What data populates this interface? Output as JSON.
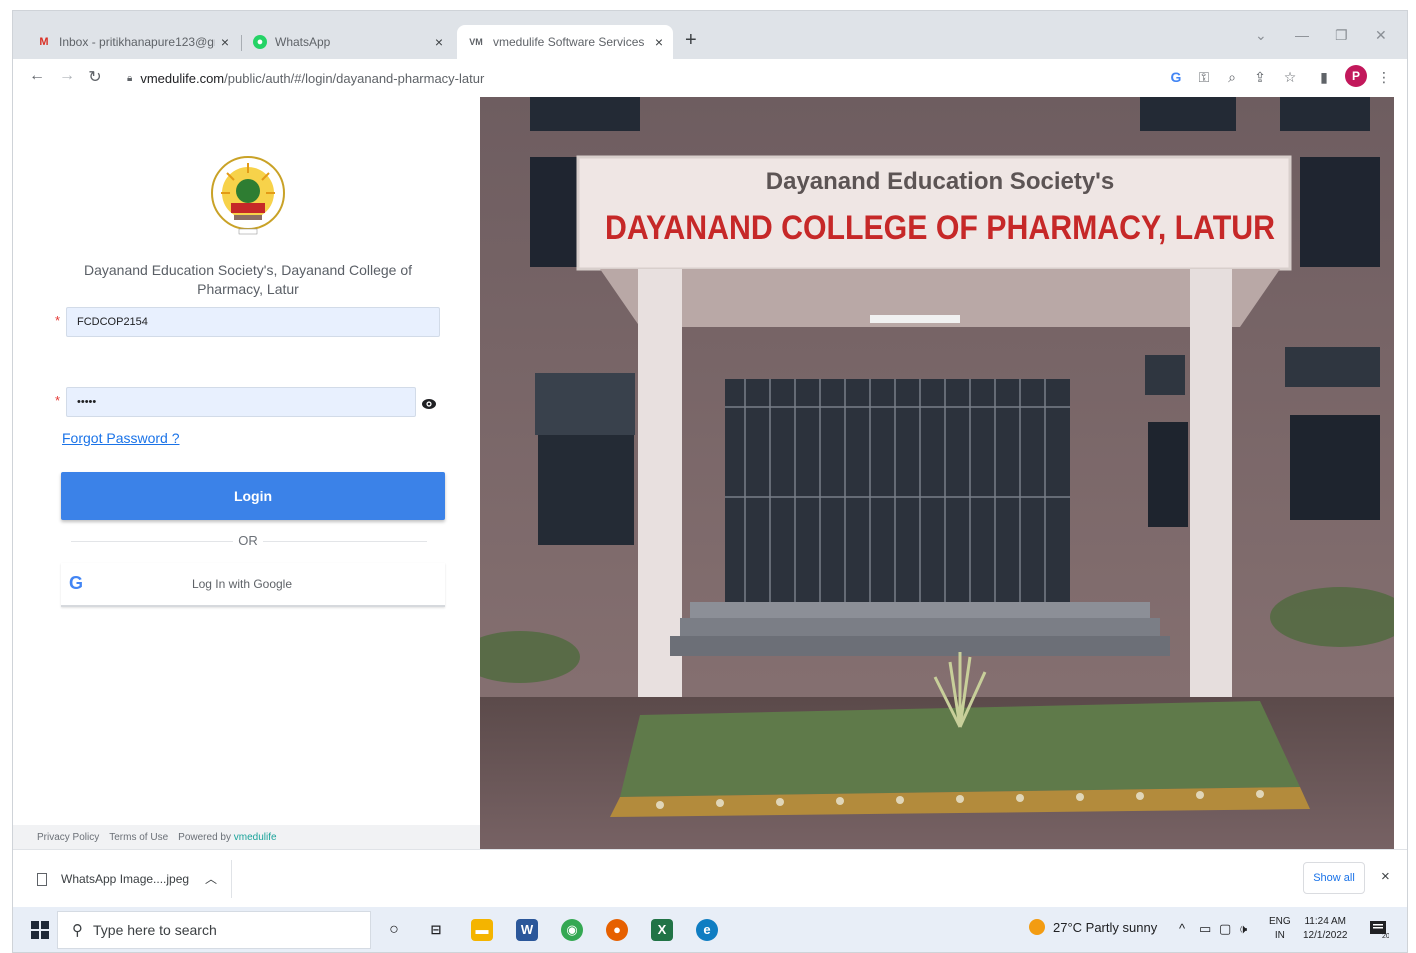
{
  "tabs": [
    {
      "title": "Inbox - pritikhanapure123@gm..."
    },
    {
      "title": "WhatsApp"
    },
    {
      "title": "vmedulife Software Services"
    }
  ],
  "address": {
    "host": "vmedulife.com",
    "path": "/public/auth/#/login/dayanand-pharmacy-latur"
  },
  "profile_initial": "P",
  "login": {
    "org_name": "Dayanand Education Society's, Dayanand College of Pharmacy, Latur",
    "username_value": "FCDCOP2154",
    "password_value": "•••••",
    "required_mark": "*",
    "forgot_label": "Forgot Password ?",
    "login_label": "Login",
    "or_label": "OR",
    "google_label": "Log In with Google",
    "google_glyph": "G"
  },
  "footer": {
    "privacy": "Privacy Policy",
    "terms": "Terms of Use",
    "powered": "Powered by",
    "brand": "vmedulife"
  },
  "photo": {
    "society_sign": "Dayanand Education Society's",
    "college_sign": "DAYANAND COLLEGE OF PHARMACY, LATUR"
  },
  "downloads": {
    "file": "WhatsApp Image....jpeg",
    "show_all": "Show all",
    "close": "×"
  },
  "taskbar": {
    "search_placeholder": "Type here to search",
    "weather": "27°C  Partly sunny",
    "lang_top": "ENG",
    "lang_bottom": "IN",
    "time": "11:24 AM",
    "date": "12/1/2022",
    "notif_count": "20"
  },
  "colors": {
    "accent": "#3b82e8",
    "link": "#1a73e8",
    "brand": "#1aa39a",
    "sign_red": "#c62828"
  }
}
